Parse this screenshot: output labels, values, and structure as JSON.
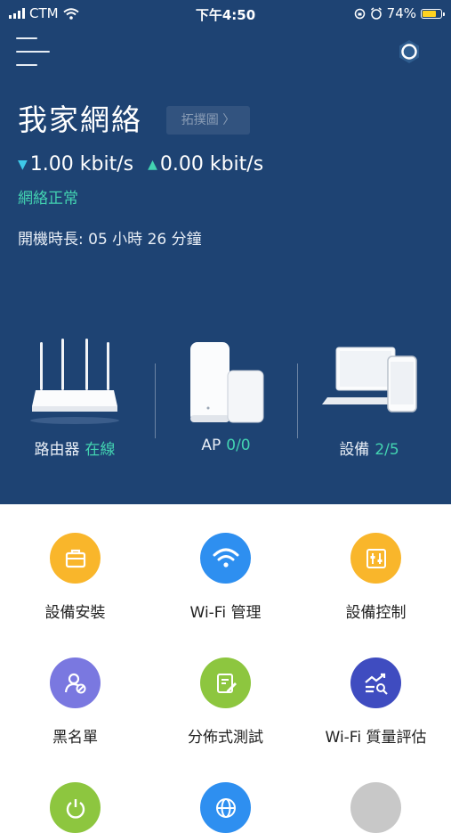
{
  "status_bar": {
    "carrier": "CTM",
    "time": "下午4:50",
    "battery": "74%",
    "battery_level": 0.74
  },
  "header": {
    "title": "我家網絡",
    "topology_button": "拓撲圖 〉"
  },
  "network": {
    "download": "1.00 kbit/s",
    "upload": "0.00 kbit/s",
    "status": "網絡正常",
    "uptime": "開機時長: 05 小時 26 分鐘"
  },
  "devices": [
    {
      "label": "路由器",
      "value": "在線"
    },
    {
      "label": "AP",
      "value": "0/0"
    },
    {
      "label": "設備",
      "value": "2/5"
    }
  ],
  "features": [
    {
      "label": "設備安裝",
      "icon": "toolbox-icon",
      "color": "#f9b62b"
    },
    {
      "label": "Wi-Fi 管理",
      "icon": "wifi-icon",
      "color": "#2e8ff0"
    },
    {
      "label": "設備控制",
      "icon": "sliders-icon",
      "color": "#f9b62b"
    },
    {
      "label": "黑名單",
      "icon": "user-block-icon",
      "color": "#7a78e0"
    },
    {
      "label": "分佈式測試",
      "icon": "edit-doc-icon",
      "color": "#8dc63f"
    },
    {
      "label": "Wi-Fi 質量評估",
      "icon": "chart-search-icon",
      "color": "#3f4cc0"
    },
    {
      "label": "",
      "icon": "power-icon",
      "color": "#8dc63f"
    },
    {
      "label": "",
      "icon": "globe-icon",
      "color": "#2e8ff0"
    },
    {
      "label": "",
      "icon": "more-icon",
      "color": "#c8c8c8"
    }
  ]
}
